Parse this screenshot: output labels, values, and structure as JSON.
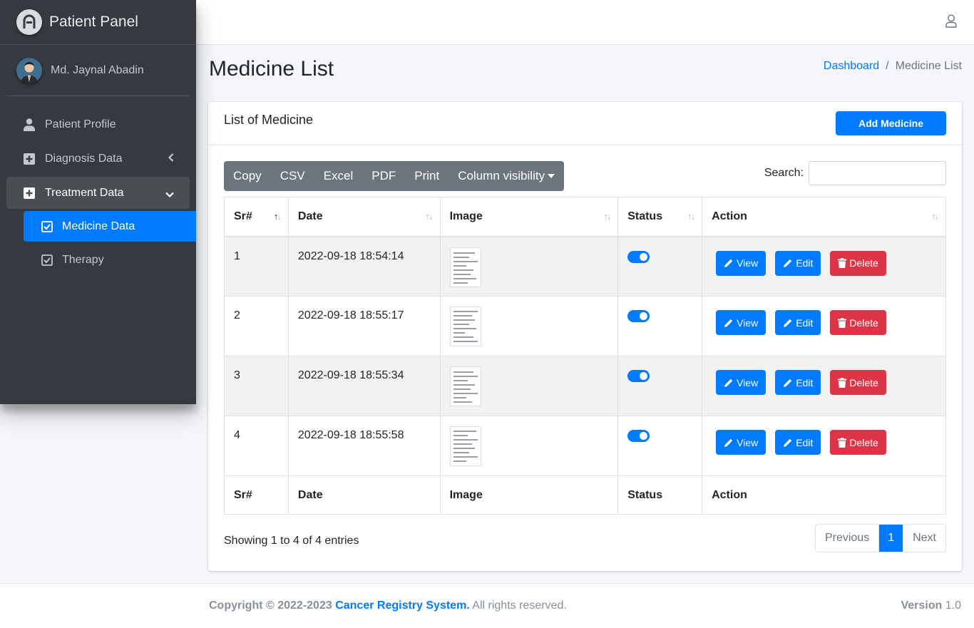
{
  "brand": {
    "name": "Patient Panel"
  },
  "user": {
    "name": "Md. Jaynal Abadin"
  },
  "sidebar": {
    "items": [
      {
        "label": "Patient Profile",
        "icon": "user-icon"
      },
      {
        "label": "Diagnosis Data",
        "icon": "plus-square-icon"
      },
      {
        "label": "Treatment Data",
        "icon": "plus-square-icon"
      }
    ],
    "subitems": [
      {
        "label": "Medicine Data",
        "icon": "check-square-icon",
        "active": true
      },
      {
        "label": "Therapy",
        "icon": "check-square-icon",
        "active": false
      }
    ]
  },
  "header": {
    "title": "Medicine List",
    "breadcrumb": {
      "home": "Dashboard",
      "separator": "/",
      "current": "Medicine List"
    }
  },
  "card": {
    "title": "List of Medicine",
    "add_button": "Add Medicine"
  },
  "toolbar": {
    "buttons": [
      "Copy",
      "CSV",
      "Excel",
      "PDF",
      "Print",
      "Column visibility"
    ],
    "search_label": "Search:"
  },
  "table": {
    "columns": [
      "Sr#",
      "Date",
      "Image",
      "Status",
      "Action"
    ],
    "rows": [
      {
        "sr": "1",
        "date": "2022-09-18 18:54:14",
        "status": true
      },
      {
        "sr": "2",
        "date": "2022-09-18 18:55:17",
        "status": true
      },
      {
        "sr": "3",
        "date": "2022-09-18 18:55:34",
        "status": true
      },
      {
        "sr": "4",
        "date": "2022-09-18 18:55:58",
        "status": true
      }
    ],
    "action_labels": {
      "view": "View",
      "edit": "Edit",
      "delete": "Delete"
    }
  },
  "pagination": {
    "info": "Showing 1 to 4 of 4 entries",
    "previous": "Previous",
    "current": "1",
    "next": "Next"
  },
  "footer": {
    "copyright_prefix": "Copyright © 2022-2023",
    "org": "Cancer Registry System.",
    "rights": "All rights reserved.",
    "version_label": "Version",
    "version_value": "1.0"
  },
  "colors": {
    "primary": "#007bff",
    "danger": "#dc3545",
    "sidebar": "#343a40",
    "secondary": "#6c757d"
  }
}
